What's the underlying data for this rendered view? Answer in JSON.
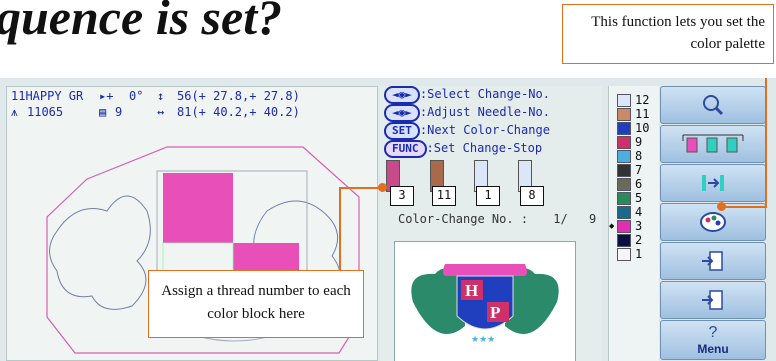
{
  "heading": "quence is set?",
  "callouts": {
    "palette": "This function lets you set the color palette",
    "assign": "Assign a thread number to each color block here"
  },
  "status": {
    "design_name": "11HAPPY GR",
    "angle": "0°",
    "stitch_count": "11065",
    "colors": "9",
    "height": "56(+ 27.8,+ 27.8)",
    "width": "81(+ 40.2,+ 40.2)"
  },
  "instructions": [
    {
      "key": "◄◄◄►►►",
      "text": ":Select Change-No."
    },
    {
      "key": "◄◄◄►►►",
      "text": ":Adjust Needle-No."
    },
    {
      "key": "SET",
      "text": ":Next Color-Change"
    },
    {
      "key": "FUNC",
      "text": ":Set Change-Stop"
    }
  ],
  "spools": [
    {
      "number": "3",
      "color": "#c94a8a"
    },
    {
      "number": "11",
      "color": "#a86a4a"
    },
    {
      "number": "1",
      "color": "#dbe6f8"
    },
    {
      "number": "8",
      "color": "#dbe6f8"
    }
  ],
  "color_change": {
    "label": "Color-Change No. :",
    "current": "1/",
    "total": "9"
  },
  "color_bar": [
    {
      "num": "12",
      "color": "#dbe6f8"
    },
    {
      "num": "11",
      "color": "#c98a6a"
    },
    {
      "num": "10",
      "color": "#1f3fbf"
    },
    {
      "num": "9",
      "color": "#d0306a"
    },
    {
      "num": "8",
      "color": "#4ab0e0"
    },
    {
      "num": "7",
      "color": "#333333"
    },
    {
      "num": "6",
      "color": "#6a6a5a"
    },
    {
      "num": "5",
      "color": "#2a8a5a"
    },
    {
      "num": "4",
      "color": "#1a6a8a"
    },
    {
      "num": "3",
      "color": "#e030b0"
    },
    {
      "num": "2",
      "color": "#0a1040"
    },
    {
      "num": "1",
      "color": "#f6f6f6"
    }
  ],
  "selected_color": "3",
  "buttons": [
    {
      "name": "zoom-button",
      "icon": "magnifier-icon"
    },
    {
      "name": "spool-sequence-button",
      "icon": "spools-icon"
    },
    {
      "name": "needle-move-button",
      "icon": "needle-arrow-icon"
    },
    {
      "name": "color-palette-button",
      "icon": "palette-icon"
    },
    {
      "name": "import-left-button",
      "icon": "import-left-icon"
    },
    {
      "name": "import-right-button",
      "icon": "import-right-icon"
    },
    {
      "name": "help-button",
      "icon": "question-icon"
    }
  ],
  "menu_label": "Menu",
  "colors": {
    "accent": "#e07020",
    "text_blue": "#1b2bb0",
    "design_pink": "#e84fb8"
  }
}
